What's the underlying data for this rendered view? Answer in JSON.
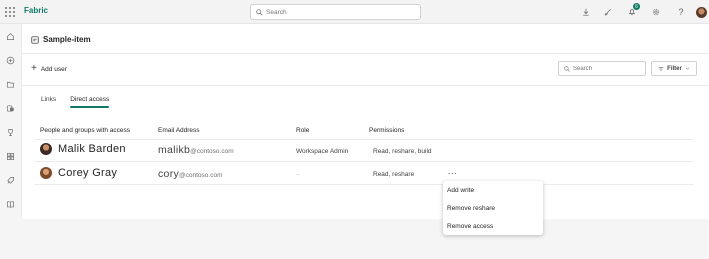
{
  "app": {
    "brand": "Fabric"
  },
  "search": {
    "placeholder": "Search"
  },
  "notifications": {
    "count": "6"
  },
  "item": {
    "title": "Sample-item"
  },
  "toolbar": {
    "add_user_label": "Add user",
    "search_placeholder": "Search",
    "filter_label": "Filter"
  },
  "tabs": [
    {
      "label": "Links",
      "active": false
    },
    {
      "label": "Direct access",
      "active": true
    }
  ],
  "table": {
    "headers": {
      "people": "People and groups with access",
      "email": "Email Address",
      "role": "Role",
      "permissions": "Permissions"
    },
    "rows": [
      {
        "name": "Malik Barden",
        "email_user": "malikb",
        "email_domain": "@contoso.com",
        "role": "Workspace Admin",
        "permissions": "Read, reshare, build",
        "more": ""
      },
      {
        "name": "Corey Gray",
        "email_user": "cory",
        "email_domain": "@contoso.com",
        "role": "-",
        "permissions": "Read, reshare",
        "more": "..."
      }
    ]
  },
  "context_menu": {
    "items": [
      "Add write",
      "Remove reshare",
      "Remove access"
    ]
  },
  "colors": {
    "accent": "#117865"
  },
  "icons": [
    "waffle-icon",
    "search-icon",
    "download-icon",
    "brush-icon",
    "bell-icon",
    "gear-icon",
    "help-icon",
    "home-icon",
    "create-icon",
    "browse-icon",
    "onelake-icon",
    "goals-icon",
    "apps-icon",
    "deployment-icon",
    "learn-icon",
    "item-icon",
    "plus-icon",
    "filter-icon",
    "chevron-down-icon"
  ]
}
